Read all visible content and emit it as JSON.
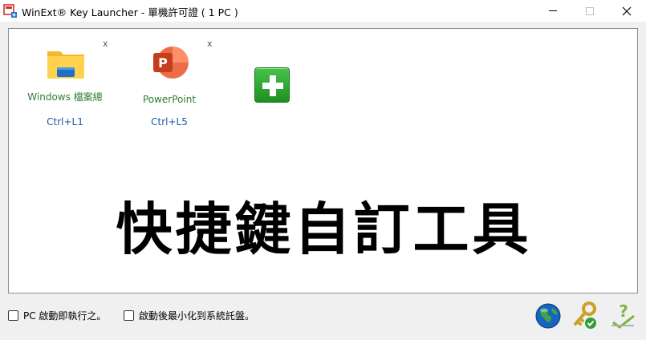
{
  "window": {
    "title": "WinExt® Key Launcher - 單機許可證 ( 1 PC )",
    "icon": "app-launcher-icon"
  },
  "launchers": [
    {
      "name": "Windows 檔案總",
      "shortcut": "Ctrl+L1",
      "icon": "folder-icon",
      "remove": "x"
    },
    {
      "name": "PowerPoint",
      "shortcut": "Ctrl+L5",
      "icon": "powerpoint-icon",
      "remove": "x"
    }
  ],
  "add_button": {
    "icon": "plus-icon"
  },
  "banner": "快捷鍵自訂工具",
  "options": [
    {
      "label": "PC 啟動即執行之。",
      "checked": false
    },
    {
      "label": "啟動後最小化到系統託盤。",
      "checked": false
    }
  ],
  "bottom_icons": [
    "globe-icon",
    "key-icon",
    "help-icon"
  ],
  "colors": {
    "launcher_name": "#2e7d32",
    "shortcut": "#1e5aa8",
    "add_button": "#2fa832"
  }
}
